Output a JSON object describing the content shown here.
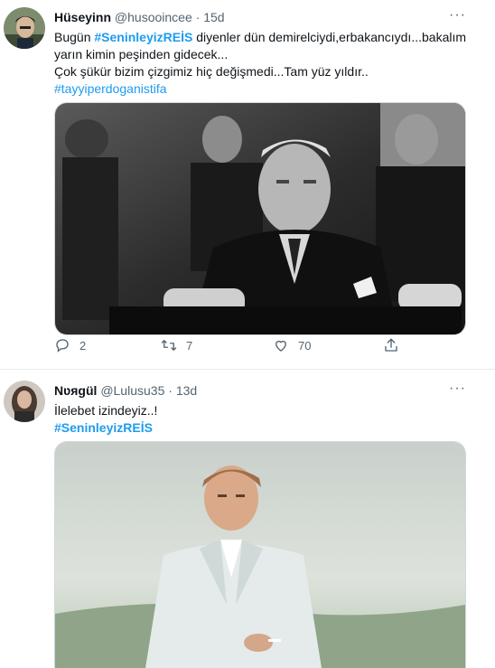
{
  "tweets": [
    {
      "display_name": "Hüseyinn",
      "handle": "@husooincee",
      "separator": "·",
      "time": "15d",
      "more": "···",
      "lines": [
        {
          "prefix": "Bugün ",
          "hashtag": "#SeninleyizREİS",
          "suffix": " diyenler dün demirelciydi,erbakancıydı...bakalım"
        },
        {
          "text": "yarın kimin peşinden gidecek..."
        },
        {
          "text": "Çok şükür bizim çizgimiz hiç değişmedi...Tam yüz yıldır.."
        },
        {
          "hashtag": "#tayyiperdoganistifa"
        }
      ],
      "image_icon": "bw-portrait-photo",
      "actions": {
        "reply_count": "2",
        "retweet_count": "7",
        "like_count": "70"
      }
    },
    {
      "display_name": "Nʋяgül",
      "handle": "@Lulusu35",
      "separator": "·",
      "time": "13d",
      "more": "···",
      "line1": "İlelebet izindeyiz..!",
      "hashtag": "#SeninleyizREİS",
      "image_icon": "color-portrait-photo"
    }
  ],
  "colors": {
    "link": "#1d9bf0",
    "muted": "#536471",
    "text": "#0f1419"
  }
}
